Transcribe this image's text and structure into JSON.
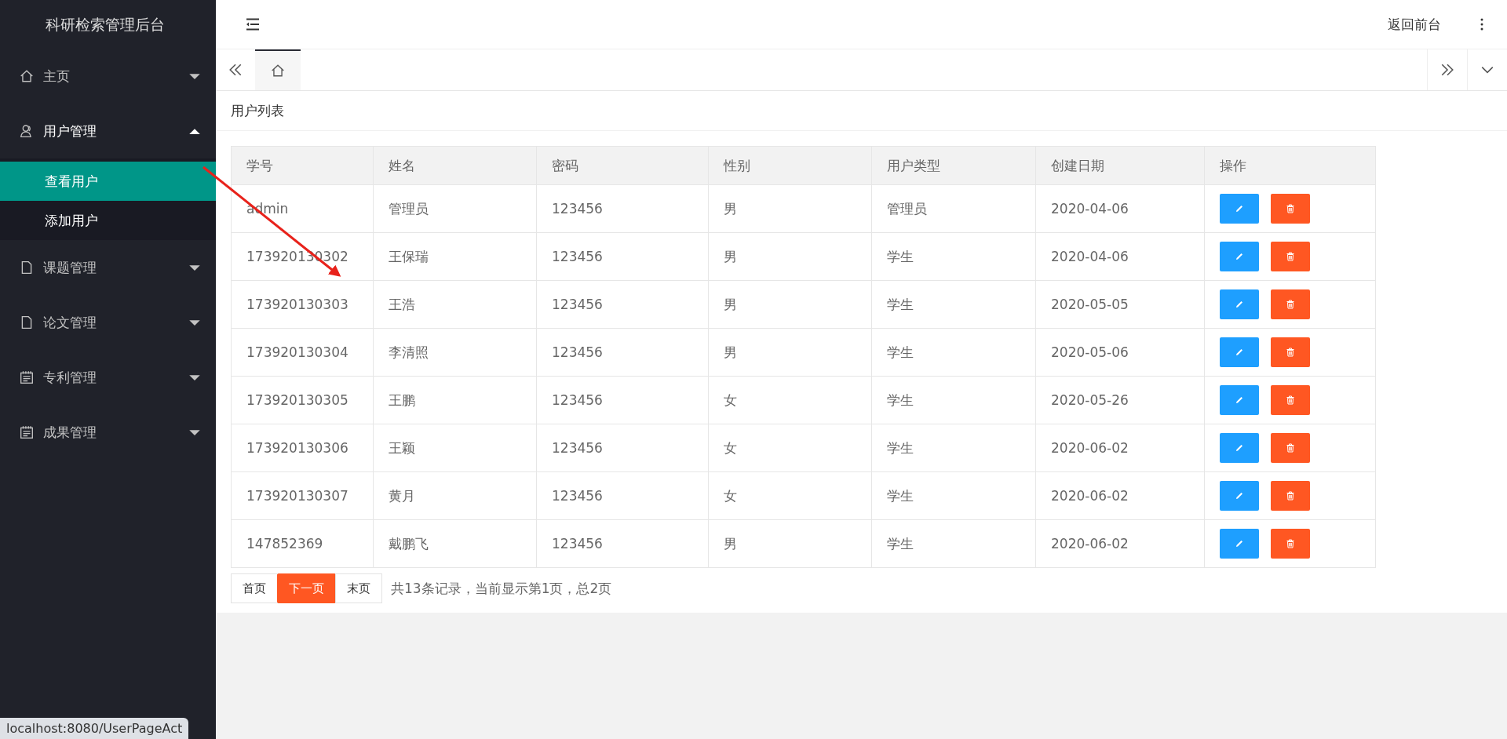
{
  "sidebar": {
    "title": "科研检索管理后台",
    "items": [
      {
        "label": "主页",
        "kind": "home",
        "expanded": false
      },
      {
        "label": "用户管理",
        "kind": "user",
        "expanded": true,
        "children": [
          {
            "label": "查看用户",
            "selected": true
          },
          {
            "label": "添加用户",
            "selected": false
          }
        ]
      },
      {
        "label": "课题管理",
        "kind": "file",
        "expanded": false
      },
      {
        "label": "论文管理",
        "kind": "file",
        "expanded": false
      },
      {
        "label": "专利管理",
        "kind": "calendar",
        "expanded": false
      },
      {
        "label": "成果管理",
        "kind": "calendar",
        "expanded": false
      }
    ]
  },
  "header": {
    "link": "返回前台"
  },
  "tabs": [
    {
      "kind": "home",
      "selected": true
    }
  ],
  "panel_title": "用户列表",
  "table": {
    "columns": [
      "学号",
      "姓名",
      "密码",
      "性别",
      "用户类型",
      "创建日期",
      "操作"
    ],
    "rows": [
      [
        "admin",
        "管理员",
        "123456",
        "男",
        "管理员",
        "2020-04-06"
      ],
      [
        "173920130302",
        "王保瑞",
        "123456",
        "男",
        "学生",
        "2020-04-06"
      ],
      [
        "173920130303",
        "王浩",
        "123456",
        "男",
        "学生",
        "2020-05-05"
      ],
      [
        "173920130304",
        "李清照",
        "123456",
        "男",
        "学生",
        "2020-05-06"
      ],
      [
        "173920130305",
        "王鹏",
        "123456",
        "女",
        "学生",
        "2020-05-26"
      ],
      [
        "173920130306",
        "王颖",
        "123456",
        "女",
        "学生",
        "2020-06-02"
      ],
      [
        "173920130307",
        "黄月",
        "123456",
        "女",
        "学生",
        "2020-06-02"
      ],
      [
        "147852369",
        "戴鹏飞",
        "123456",
        "男",
        "学生",
        "2020-06-02"
      ]
    ]
  },
  "pagination": {
    "buttons": [
      {
        "label": "首页",
        "highlighted": false
      },
      {
        "label": "下一页",
        "highlighted": true
      },
      {
        "label": "末页",
        "highlighted": false
      }
    ],
    "summary": "共13条记录，当前显示第1页，总2页"
  },
  "status_bar": "localhost:8080/UserPageAct"
}
